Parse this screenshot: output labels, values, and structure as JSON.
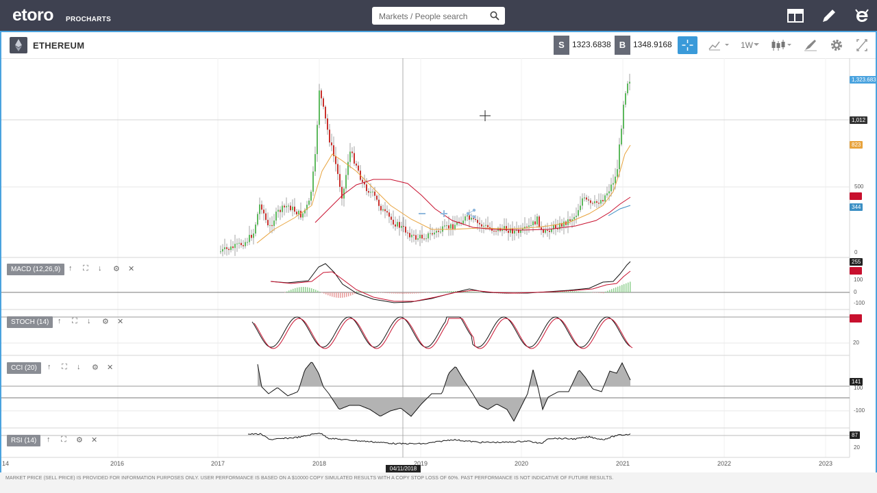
{
  "app": {
    "logo_text": "etoro",
    "logo_sub": "PROCHARTS"
  },
  "search": {
    "placeholder": "Markets / People search"
  },
  "topbar_icons": [
    "layout-icon",
    "pencil-icon",
    "etoro-e-icon"
  ],
  "instrument": {
    "name": "ETHEREUM",
    "sell_label": "S",
    "sell_price": "1323.6838",
    "buy_label": "B",
    "buy_price": "1348.9168"
  },
  "toolbar": {
    "timeframe": "1W",
    "icons": [
      "crosshair-icon",
      "chart-type-icon",
      "candles-icon",
      "draw-tool-icon",
      "gear-icon",
      "expand-icon"
    ]
  },
  "price_axis": {
    "current": "1,323.683",
    "crosshair": "1,012",
    "ma_fast": "823",
    "ma_slow": "",
    "ma_third": "344",
    "ticks": [
      "500",
      "0"
    ]
  },
  "panes": {
    "macd": {
      "label": "MACD (12,26,9)",
      "value": "255",
      "ticks": [
        "100",
        "0",
        "-100"
      ]
    },
    "stoch": {
      "label": "STOCH (14)",
      "ticks": [
        "20"
      ]
    },
    "cci": {
      "label": "CCI (20)",
      "value": "141",
      "ticks": [
        "100",
        "-100"
      ]
    },
    "rsi": {
      "label": "RSI (14)",
      "value": "87",
      "ticks": [
        "20"
      ]
    }
  },
  "colors": {
    "accent": "#3a9ad9",
    "topbar": "#3e4150",
    "up": "#5cb85c",
    "down": "#c9302c",
    "ma_orange": "#e8a33d",
    "ma_red": "#c8102e",
    "ma_blue": "#3b8fc4"
  },
  "x_axis": {
    "labels": [
      "14",
      "2016",
      "2017",
      "2018",
      "2019",
      "2020",
      "2021",
      "2022",
      "2023"
    ],
    "crosshair_date": "04/11/2018"
  },
  "footer": {
    "disclaimer": "MARKET PRICE (SELL PRICE) IS PROVIDED FOR INFORMATION PURPOSES ONLY. USER PERFORMANCE IS BASED ON A $10000 COPY SIMULATED RESULTS WITH A COPY STOP LOSS OF 60%. PAST PERFORMANCE IS NOT INDICATIVE OF FUTURE RESULTS."
  }
}
